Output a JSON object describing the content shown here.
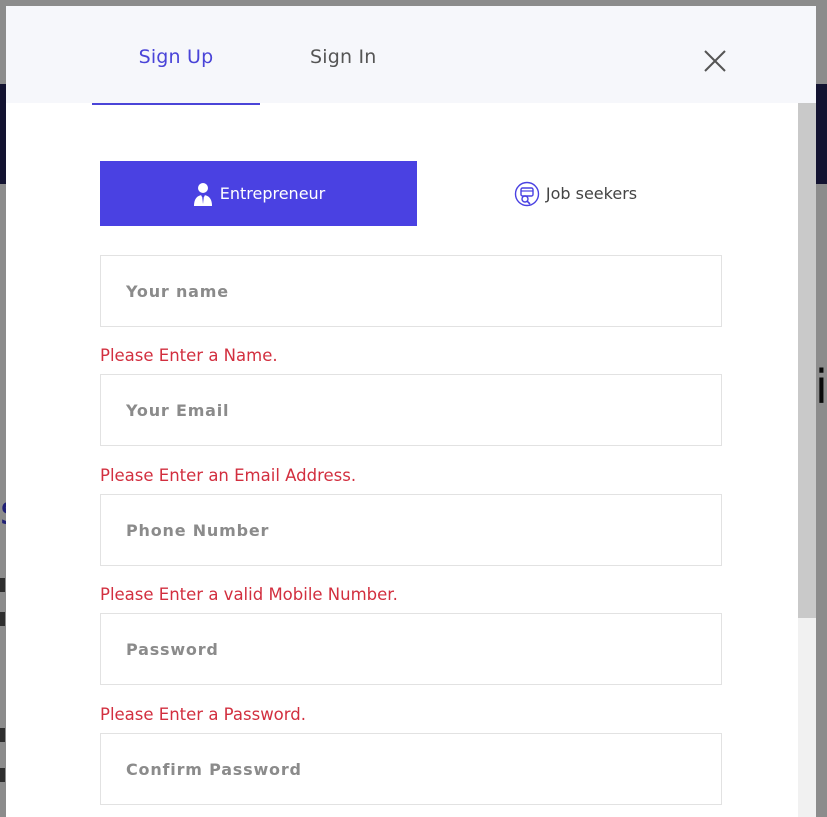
{
  "tabs": {
    "signup": "Sign Up",
    "signin": "Sign In"
  },
  "roles": {
    "entrepreneur": "Entrepreneur",
    "jobseekers": "Job seekers"
  },
  "fields": {
    "name": {
      "placeholder": "Your name",
      "error": "Please Enter a Name."
    },
    "email": {
      "placeholder": "Your Email",
      "error": "Please Enter an Email Address."
    },
    "phone": {
      "placeholder": "Phone Number",
      "error": "Please Enter a valid Mobile Number."
    },
    "password": {
      "placeholder": "Password",
      "error": "Please Enter a Password."
    },
    "confirm": {
      "placeholder": "Confirm Password"
    }
  },
  "colors": {
    "accent": "#4a41e2",
    "error": "#d22f3f",
    "header_bg": "#f6f7fb"
  },
  "icons": {
    "close": "close-icon",
    "entrepreneur": "businessman-icon",
    "jobseekers": "job-seeker-icon"
  }
}
